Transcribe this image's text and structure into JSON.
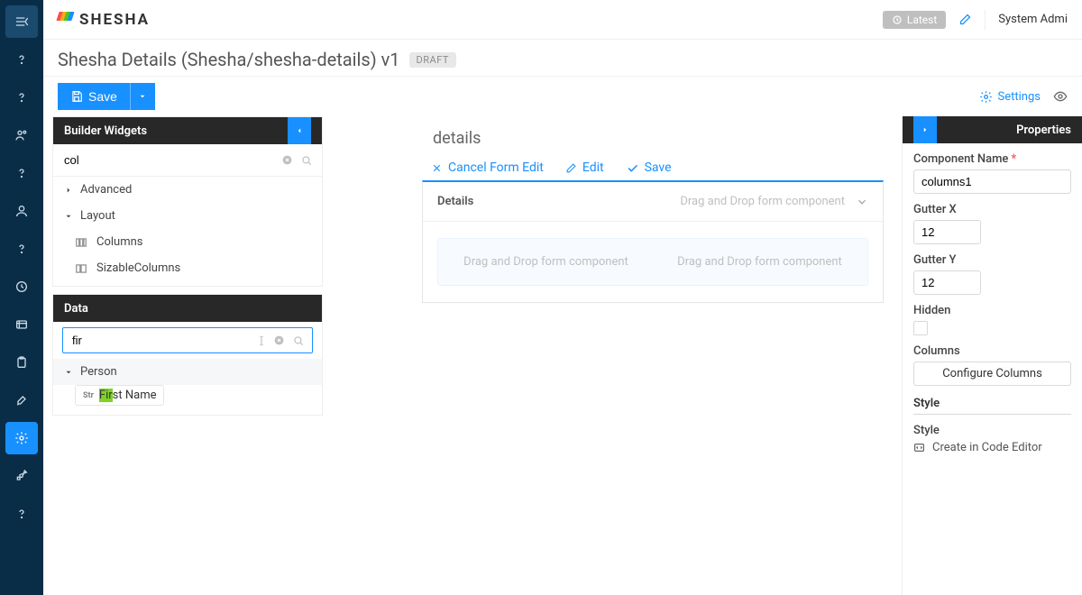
{
  "brand": {
    "name": "SHESHA"
  },
  "header": {
    "latest_label": "Latest",
    "user_name": "System Admi",
    "edit_icon": "pencil-icon"
  },
  "title": {
    "text": "Shesha Details (Shesha/shesha-details) v1",
    "badge": "DRAFT"
  },
  "toolbar": {
    "save_label": "Save",
    "settings_label": "Settings"
  },
  "widgets_panel": {
    "title": "Builder Widgets",
    "search_value": "col",
    "categories": [
      {
        "name": "Advanced",
        "expanded": false
      },
      {
        "name": "Layout",
        "expanded": true,
        "items": [
          {
            "icon": "columns-icon",
            "label": "Columns"
          },
          {
            "icon": "sizable-columns-icon",
            "label": "SizableColumns"
          }
        ]
      }
    ]
  },
  "data_panel": {
    "title": "Data",
    "search_value": "fir",
    "groups": [
      {
        "name": "Person",
        "items": [
          {
            "type_tag": "Str",
            "label_hl": "Fir",
            "label_rest": "st Name"
          }
        ]
      }
    ]
  },
  "canvas": {
    "heading": "details",
    "actions": {
      "cancel": "Cancel Form Edit",
      "edit": "Edit",
      "save": "Save"
    },
    "card": {
      "title": "Details",
      "drop_hint": "Drag and Drop form component",
      "dz1": "Drag and Drop form component",
      "dz2": "Drag and Drop form component"
    }
  },
  "properties": {
    "title": "Properties",
    "fields": {
      "component_name": {
        "label": "Component Name",
        "value": "columns1",
        "required": true
      },
      "gutter_x": {
        "label": "Gutter X",
        "value": "12"
      },
      "gutter_y": {
        "label": "Gutter Y",
        "value": "12"
      },
      "hidden": {
        "label": "Hidden",
        "value": false
      },
      "columns": {
        "label": "Columns",
        "button": "Configure Columns"
      },
      "style_heading": "Style",
      "style_label": "Style",
      "code_btn": "Create in Code Editor"
    }
  },
  "rail_icons": [
    "menu-icon",
    "help-icon",
    "help-icon",
    "user-group-icon",
    "help-icon",
    "user-icon",
    "help-icon",
    "clock-icon",
    "bullet-list-icon",
    "clipboard-icon",
    "tool-icon",
    "gear-icon",
    "brush-icon",
    "help-icon"
  ]
}
